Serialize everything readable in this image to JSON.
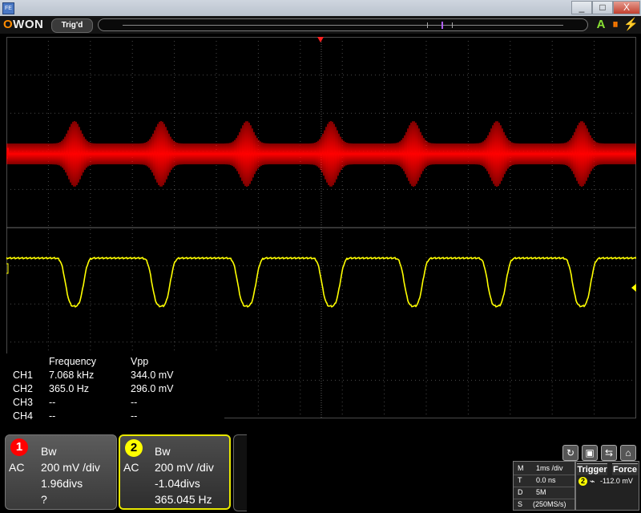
{
  "window": {
    "icon_text": "FE",
    "min_label": "_",
    "max_label": "□",
    "close_label": "X"
  },
  "toolbar": {
    "brand_o": "O",
    "brand_rest": "WON",
    "trigger_status": "Trig'd",
    "icons": [
      "auto-set-icon",
      "run-stop-icon",
      "power-icon"
    ],
    "icon_glyphs": [
      "A",
      "⏸",
      "⚡"
    ],
    "icon_colors": [
      "#8ae234",
      "#ff7a00",
      "#ffd700"
    ]
  },
  "colors": {
    "ch1": "#ff0000",
    "ch2": "#ffff00",
    "grid": "#4a4a4a",
    "trigger_marker": "#ff2020"
  },
  "measurements": {
    "headers": [
      "Frequency",
      "Vpp"
    ],
    "rows": [
      {
        "channel": "CH1",
        "frequency": "7.068 kHz",
        "vpp": "344.0 mV"
      },
      {
        "channel": "CH2",
        "frequency": "365.0 Hz",
        "vpp": "296.0 mV"
      },
      {
        "channel": "CH3",
        "frequency": "--",
        "vpp": "--"
      },
      {
        "channel": "CH4",
        "frequency": "--",
        "vpp": "--"
      }
    ]
  },
  "ch1": {
    "number": "1",
    "bw": "Bw",
    "coupling": "AC",
    "scale": "200 mV /div",
    "offset": "1.96divs",
    "freq": "?"
  },
  "ch2": {
    "number": "2",
    "bw": "Bw",
    "coupling": "AC",
    "scale": "200 mV /div",
    "offset": "-1.04divs",
    "freq": "365.045 Hz"
  },
  "timebase": {
    "rows": [
      {
        "key": "M",
        "value": "1ms /div"
      },
      {
        "key": "T",
        "value": "0.0 ns"
      },
      {
        "key": "D",
        "value": "5M"
      },
      {
        "key": "S",
        "value": "(250MS/s)"
      }
    ]
  },
  "trigger": {
    "label": "Trigger",
    "force_label": "Force",
    "source": "2",
    "level": "-112.0 mV"
  },
  "bottom_icons": [
    "refresh-icon",
    "save-icon",
    "settings-icon",
    "home-icon"
  ],
  "bottom_glyphs": [
    "↻",
    "▣",
    "⇆",
    "⌂"
  ]
}
